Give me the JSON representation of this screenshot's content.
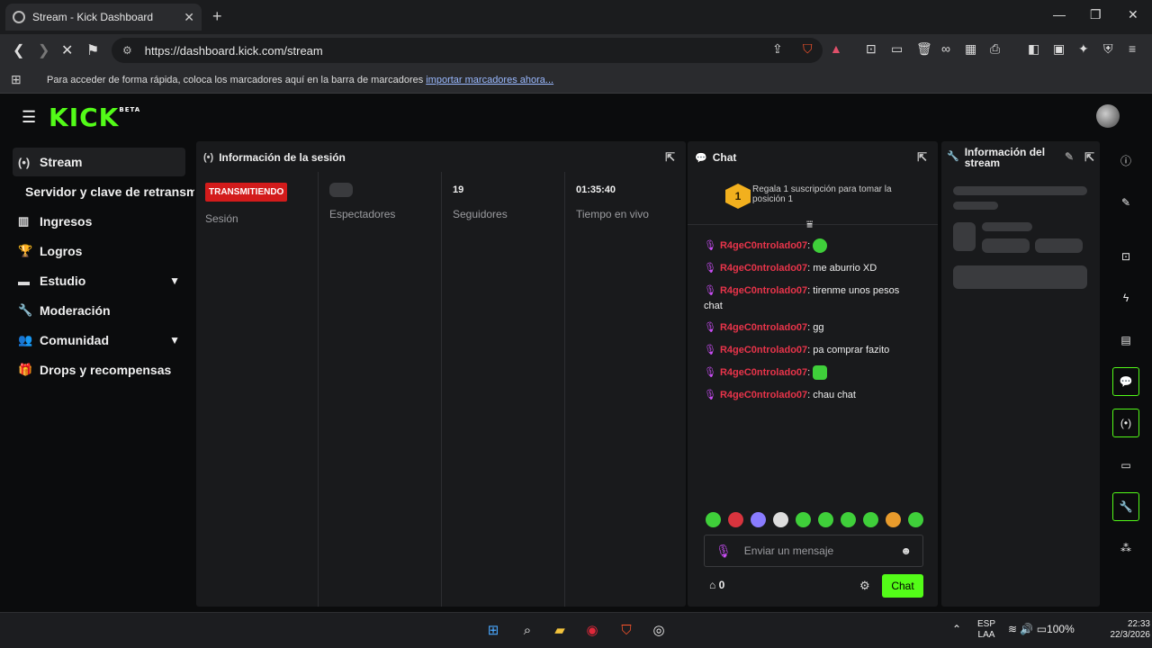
{
  "browser": {
    "tab_title": "Stream - Kick Dashboard",
    "url": "https://dashboard.kick.com/stream",
    "bookmarks_text": "Para acceder de forma rápida, coloca los marcadores aquí en la barra de marcadores",
    "bookmarks_link": "importar marcadores ahora..."
  },
  "brand": {
    "logo": "KICK",
    "logo_sup": "BETA",
    "accent": "#53fc18"
  },
  "sidebar": {
    "items": [
      {
        "label": "Stream",
        "icon": "broadcast-icon"
      },
      {
        "label": "Servidor y clave de retransm"
      },
      {
        "label": "Ingresos",
        "icon": "chart-icon"
      },
      {
        "label": "Logros",
        "icon": "trophy-icon"
      },
      {
        "label": "Estudio",
        "icon": "studio-icon"
      },
      {
        "label": "Moderación",
        "icon": "wrench-icon"
      },
      {
        "label": "Comunidad",
        "icon": "community-icon"
      },
      {
        "label": "Drops y recompensas",
        "icon": "gift-icon"
      }
    ]
  },
  "session": {
    "title": "Información de la sesión",
    "badge": "TRANSMITIENDO",
    "session_label": "Sesión",
    "viewers_label": "Espectadores",
    "followers_value": "19",
    "followers_label": "Seguidores",
    "live_value": "01:35:40",
    "live_label": "Tiempo en vivo"
  },
  "chat": {
    "title": "Chat",
    "gift_number": "1",
    "gift_text": "Regala 1 suscripción para tomar la posición 1",
    "messages": [
      {
        "user": "R4geC0ntrolado07",
        "text": ":"
      },
      {
        "user": "R4geC0ntrolado07",
        "text": ": me aburrio XD"
      },
      {
        "user": "R4geC0ntrolado07",
        "text": ": tirenme unos pesos chat"
      },
      {
        "user": "R4geC0ntrolado07",
        "text": ": gg"
      },
      {
        "user": "R4geC0ntrolado07",
        "text": ": pa comprar fazito"
      },
      {
        "user": "R4geC0ntrolado07",
        "text": ":"
      },
      {
        "user": "R4geC0ntrolado07",
        "text": ": chau chat"
      }
    ],
    "input_placeholder": "Enviar un mensaje",
    "points": "0",
    "send_label": "Chat"
  },
  "stream_info": {
    "title": "Información del stream"
  },
  "taskbar": {
    "lang1": "ESP",
    "lang2": "LAA",
    "battery": "100%",
    "time": "22:33",
    "date": "22/3/2026"
  }
}
